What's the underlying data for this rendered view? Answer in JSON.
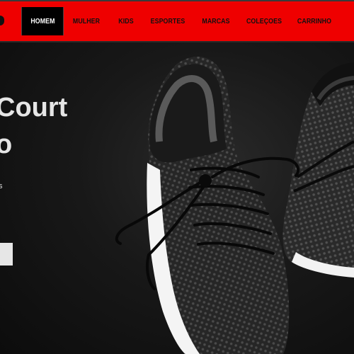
{
  "nav": {
    "items": [
      {
        "label": "HOMEM",
        "active": true
      },
      {
        "label": "MULHER",
        "active": false
      },
      {
        "label": "KIDS",
        "active": false
      },
      {
        "label": "ESPORTES",
        "active": false
      },
      {
        "label": "MARCAS",
        "active": false
      },
      {
        "label": "COLEÇOES",
        "active": false
      },
      {
        "label": "CARRINHO",
        "active": false
      }
    ]
  },
  "hero": {
    "title": "Court\no",
    "subtitle": "s",
    "cta_label": ""
  },
  "colors": {
    "nav_background": "#ef0000",
    "active_item_background": "#000000",
    "hero_background": "#151515",
    "text_light": "#e6e6e6"
  },
  "icons": [
    "logo-icon"
  ]
}
